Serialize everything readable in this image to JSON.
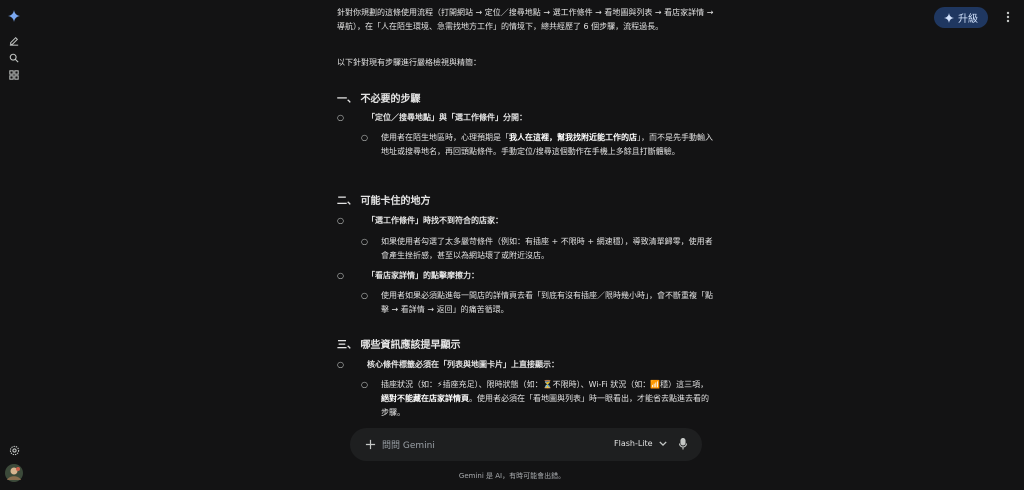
{
  "header": {
    "upgrade_label": "升級"
  },
  "content": {
    "intro": "針對你規劃的這條使用流程（打開網站 → 定位／搜尋地點 → 選工作條件 → 看地圖與列表 → 看店家詳情 → 導航），在「人在陌生環境、急需找地方工作」的情境下，總共經歷了 6 個步驟，流程過長。",
    "lead": "以下針對現有步驟進行嚴格檢視與精簡：",
    "sections": [
      {
        "heading": "一、 不必要的步驟",
        "items": [
          {
            "title": "「定位／搜尋地點」與「選工作條件」分開：",
            "detail_pre": "使用者在陌生地區時，心理預期是「",
            "detail_hl": "我人在這裡，幫我找附近能工作的店",
            "detail_post": "」，而不是先手動輸入地址或搜尋地名，再回頭點條件。手動定位/搜尋這個動作在手機上多餘且打斷體驗。"
          }
        ]
      },
      {
        "heading": "二、 可能卡住的地方",
        "items": [
          {
            "title": "「選工作條件」時找不到符合的店家：",
            "detail": "如果使用者勾選了太多嚴苛條件（例如：有插座 + 不限時 + 網速穩），導致清單歸零，使用者會產生挫折感，甚至以為網站壞了或附近沒店。"
          },
          {
            "title": "「看店家詳情」的點擊摩擦力：",
            "detail": "使用者如果必須點進每一間店的詳情頁去看「到底有沒有插座／限時幾小時」，會不斷重複「點擊 → 看詳情 → 返回」的痛苦循環。"
          }
        ]
      },
      {
        "heading": "三、 哪些資訊應該提早顯示",
        "items": [
          {
            "title": "核心條件標籤必須在「列表與地圖卡片」上直接顯示：",
            "detail_a": "插座狀況（如：⚡插座充足）、限時狀態（如：⏳不限時）、Wi-Fi 狀況（如：📶穩）這三項，",
            "detail_hl": "絕對不能藏在店家詳情頁",
            "detail_b": "。使用者必須在「看地圖與列表」時一眼看出，才能省去點進去看的步驟。"
          }
        ]
      }
    ]
  },
  "input": {
    "placeholder": "問問 Gemini",
    "model": "Flash-Lite"
  },
  "footer": {
    "disclaimer": "Gemini 是 AI，有時可能會出錯。"
  },
  "colors": {
    "background": "#131314",
    "upgrade_bg": "#1f3760",
    "input_bg": "#1e1f20"
  }
}
